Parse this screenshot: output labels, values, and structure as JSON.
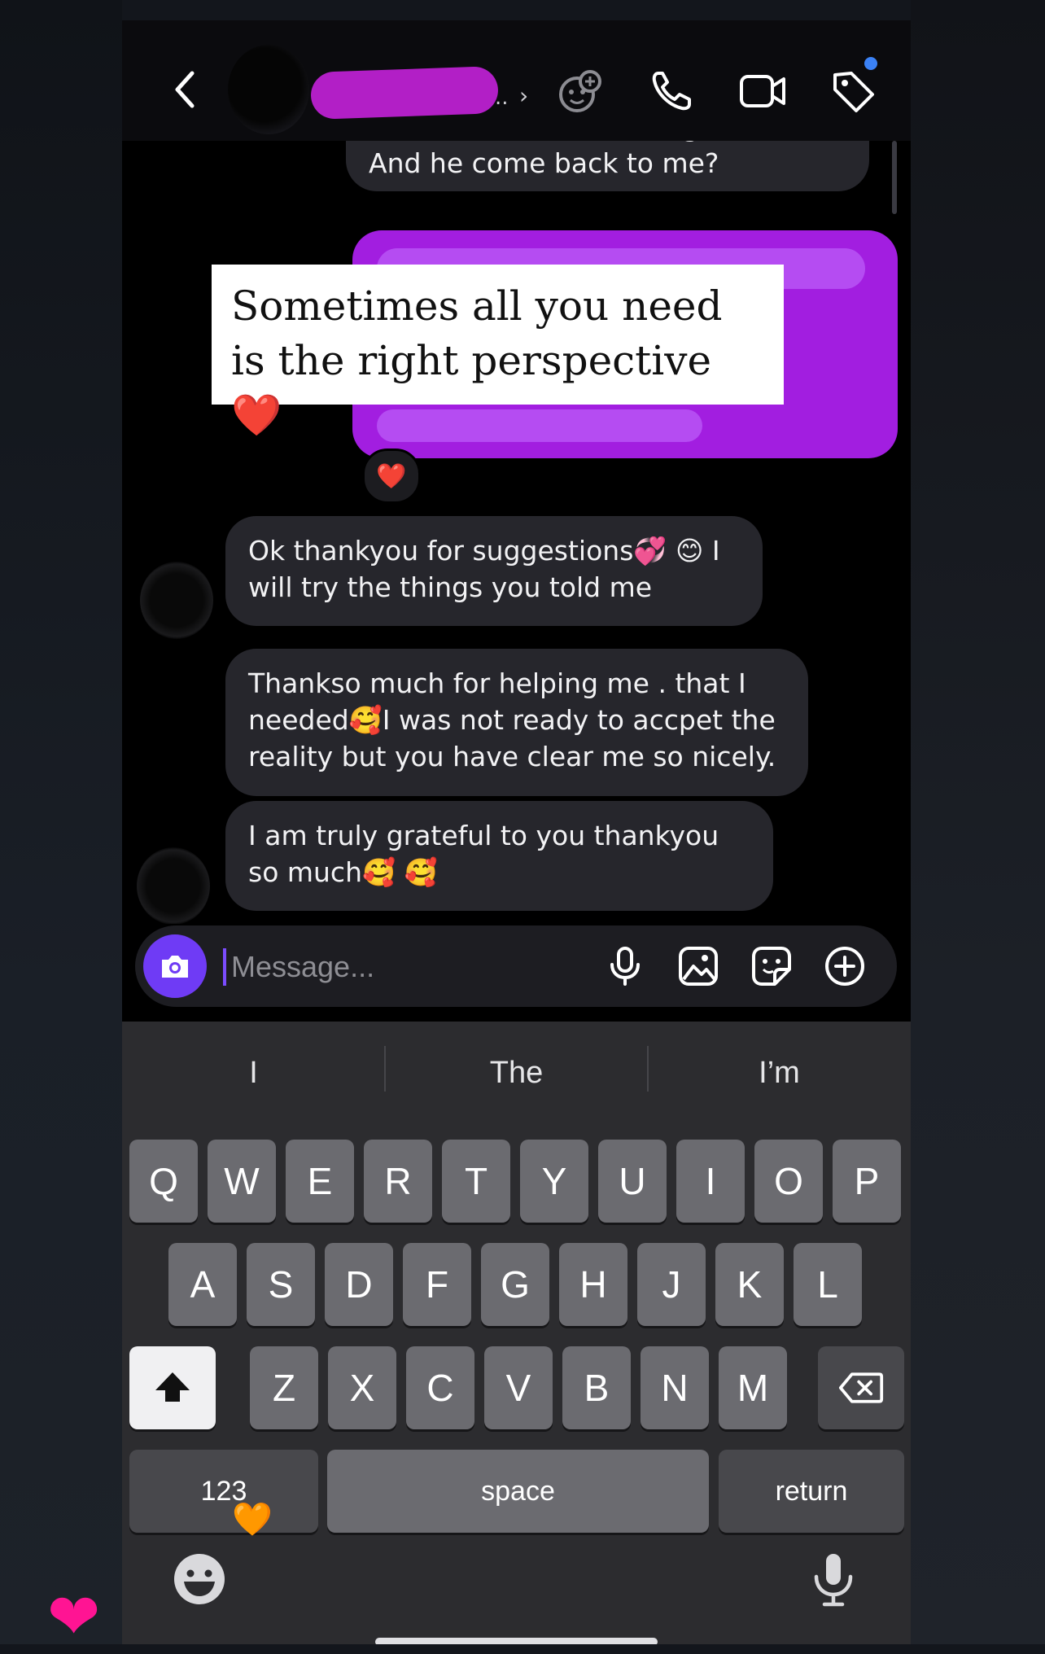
{
  "header": {
    "back_icon": "chevron-left-icon",
    "name_ellipsis": "..",
    "actions": [
      "effects-icon",
      "phone-icon",
      "video-camera-icon",
      "tag-icon"
    ],
    "notification_color": "#3b82f6"
  },
  "chat": {
    "partial_message": "What should I do if I forget him? And he come back to me?",
    "sent_reaction": "❤️",
    "caption_overlay": "Sometimes all you need is the right perspective ❤️",
    "messages": [
      "Ok thankyou for suggestions💞 😊 I will try the things you told me",
      "Thankso much for helping me . that I needed🥰I was not ready to accpet the reality but you have clear me so nicely.",
      "I am truly grateful to you thankyou so much🥰 🥰"
    ],
    "colors": {
      "sent_bubble": "#a21ee0",
      "received_bubble": "#26262c",
      "camera_button": "#6f3bf5"
    }
  },
  "composer": {
    "placeholder": "Message...",
    "icons": [
      "camera-icon",
      "microphone-icon",
      "gallery-icon",
      "sticker-icon",
      "plus-icon"
    ]
  },
  "keyboard": {
    "suggestions": [
      "I",
      "The",
      "I’m"
    ],
    "row1": [
      "Q",
      "W",
      "E",
      "R",
      "T",
      "Y",
      "U",
      "I",
      "O",
      "P"
    ],
    "row2": [
      "A",
      "S",
      "D",
      "F",
      "G",
      "H",
      "J",
      "K",
      "L"
    ],
    "row3": [
      "Z",
      "X",
      "C",
      "V",
      "B",
      "N",
      "M"
    ],
    "numbers_label": "123",
    "space_label": "space",
    "return_label": "return"
  },
  "overlays": {
    "hearts": [
      "🧡",
      "❤"
    ]
  }
}
